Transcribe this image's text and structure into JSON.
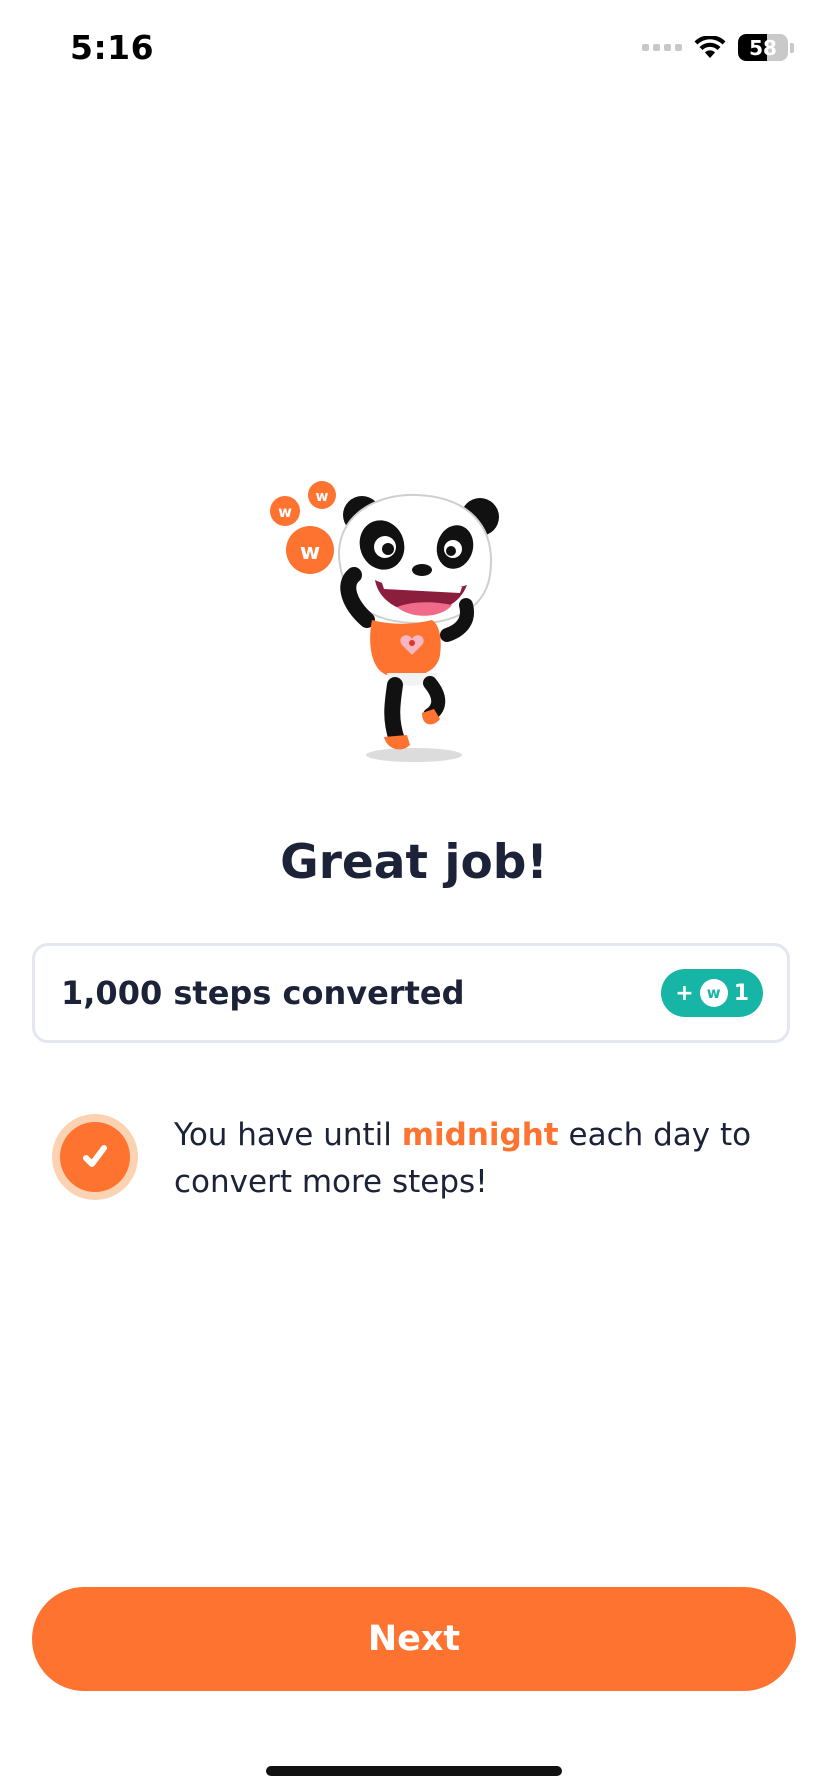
{
  "status_bar": {
    "time": "5:16",
    "battery_level": "58",
    "battery_fraction": 0.58
  },
  "illustration": {
    "name": "panda-celebrating",
    "coin_letter": "w"
  },
  "title": "Great job!",
  "steps_card": {
    "label": "1,000 steps converted",
    "reward_prefix": "+",
    "reward_coin_letter": "w",
    "reward_amount": "1"
  },
  "info": {
    "text_before": "You have until ",
    "highlight": "midnight",
    "text_after": " each day to convert more steps!"
  },
  "next_button": {
    "label": "Next"
  },
  "colors": {
    "accent": "#ff7330",
    "accent_light": "#fbd3b3",
    "teal": "#17b5a6",
    "text": "#1c2237",
    "card_border": "#e4e7ef"
  },
  "icons": [
    "wifi-icon",
    "battery-icon",
    "cellular-signal-icon",
    "check-icon",
    "coin-icon"
  ]
}
